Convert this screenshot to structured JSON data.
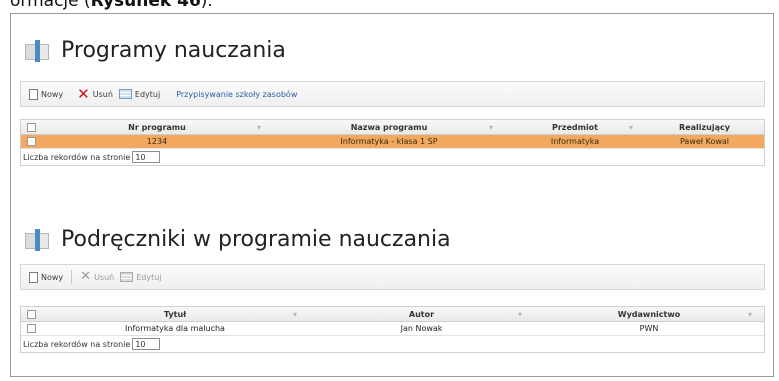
{
  "caption": {
    "prefix": "ormacje (",
    "bold": "Rysunek 46",
    "suffix": ")."
  },
  "programs": {
    "title": "Programy nauczania",
    "toolbar": {
      "new": "Nowy",
      "delete": "Usuń",
      "edit": "Edytuj",
      "link": "Przypisywanie szkoły zasobów"
    },
    "columns": [
      "Nr programu",
      "Nazwa programu",
      "Przedmiot",
      "Realizujący"
    ],
    "rows": [
      {
        "number": "1234",
        "name": "Informatyka - klasa 1 SP",
        "subject": "Informatyka",
        "teacher": "Paweł Kowal",
        "selected": true
      }
    ],
    "footer": {
      "label": "Liczba rekordów na stronie",
      "value": "10"
    }
  },
  "books": {
    "title": "Podręczniki w programie nauczania",
    "toolbar": {
      "new": "Nowy",
      "delete": "Usuń",
      "edit": "Edytuj"
    },
    "columns": [
      "Tytuł",
      "Autor",
      "Wydawnictwo"
    ],
    "rows": [
      {
        "title": "Informatyka dla malucha",
        "author": "Jan Nowak",
        "publisher": "PWN"
      }
    ],
    "footer": {
      "label": "Liczba rekordów na stronie",
      "value": "10"
    }
  }
}
